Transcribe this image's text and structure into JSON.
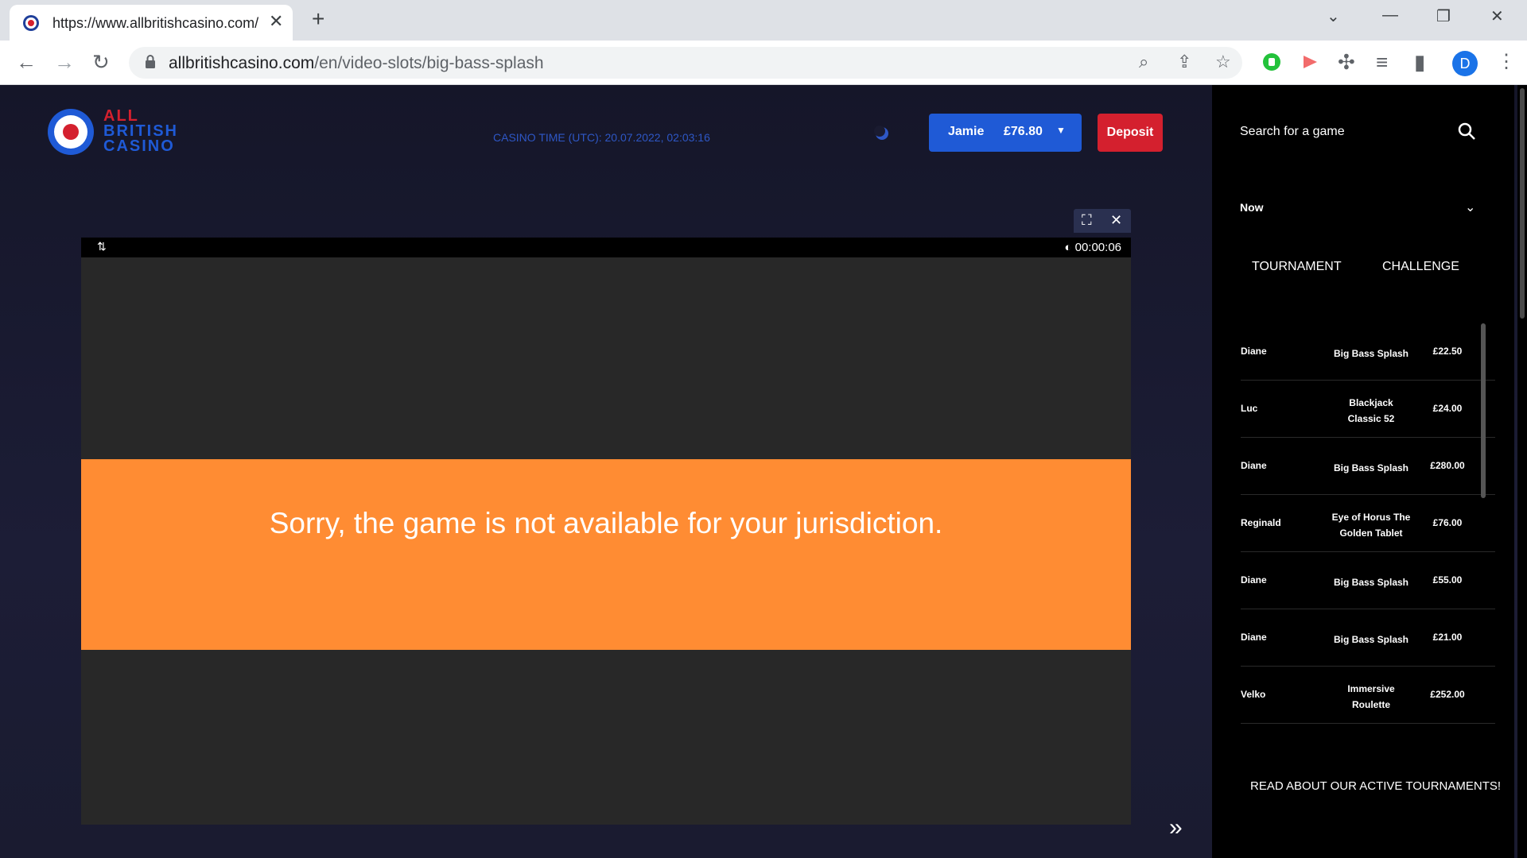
{
  "browser": {
    "tab_title": "https://www.allbritishcasino.com/",
    "url_host": "allbritishcasino.com",
    "url_path": "/en/video-slots/big-bass-splash",
    "profile_initial": "D"
  },
  "header": {
    "logo_line1": "ALL",
    "logo_line2": "BRITISH",
    "logo_line3": "CASINO",
    "casino_time": "CASINO TIME (UTC): 20.07.2022, 02:03:16",
    "account_name": "Jamie",
    "balance": "£76.80",
    "deposit_label": "Deposit"
  },
  "game": {
    "timer": "00:00:06",
    "error_message": "Sorry, the game is not available for your jurisdiction."
  },
  "sidebar": {
    "search_placeholder": "Search for a game",
    "period": "Now",
    "tabs": [
      "TOURNAMENT",
      "CHALLENGE"
    ],
    "winners": [
      {
        "player": "Diane",
        "game": "Big Bass Splash",
        "amount": "£22.50"
      },
      {
        "player": "Luc",
        "game": "Blackjack Classic 52",
        "amount": "£24.00"
      },
      {
        "player": "Diane",
        "game": "Big Bass Splash",
        "amount": "£280.00"
      },
      {
        "player": "Reginald",
        "game": "Eye of Horus The Golden Tablet",
        "amount": "£76.00"
      },
      {
        "player": "Diane",
        "game": "Big Bass Splash",
        "amount": "£55.00"
      },
      {
        "player": "Diane",
        "game": "Big Bass Splash",
        "amount": "£21.00"
      },
      {
        "player": "Velko",
        "game": "Immersive Roulette",
        "amount": "£252.00"
      }
    ],
    "read_link": "READ ABOUT OUR ACTIVE TOURNAMENTS!"
  },
  "colors": {
    "brand_blue": "#1f5ad6",
    "brand_red": "#d4202e",
    "error_orange": "#ff8c33"
  }
}
